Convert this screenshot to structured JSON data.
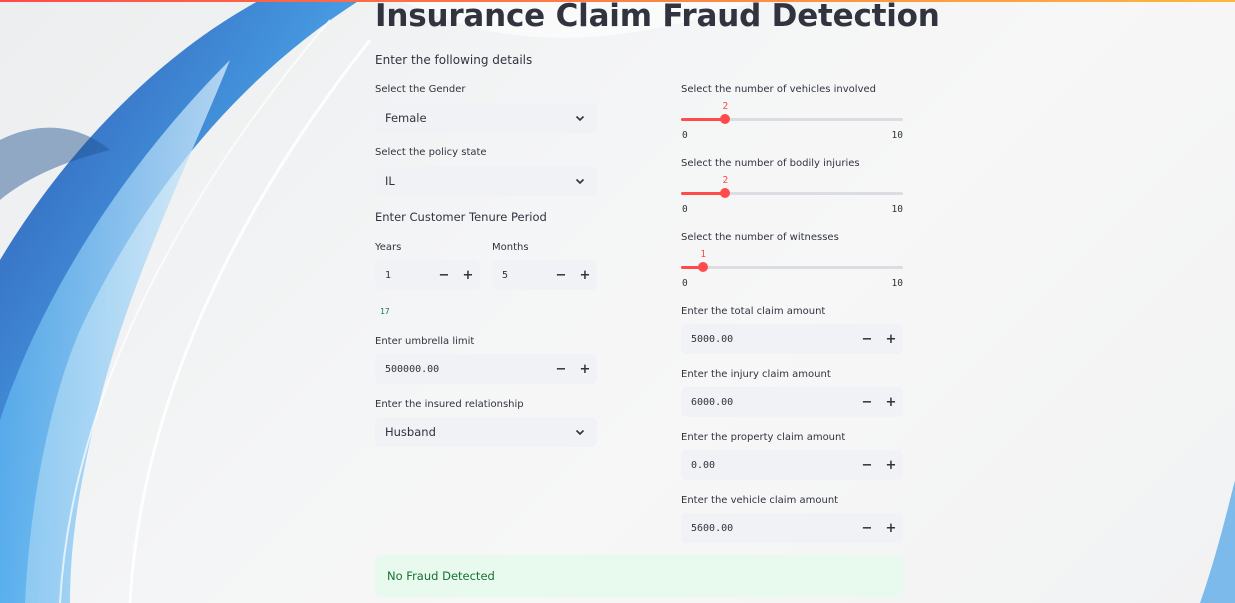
{
  "app": {
    "title": "Insurance Claim Fraud Detection",
    "intro": "Enter the following details"
  },
  "left": {
    "gender": {
      "label": "Select the Gender",
      "value": "Female"
    },
    "policy_state": {
      "label": "Select the policy state",
      "value": "IL"
    },
    "tenure": {
      "label": "Enter Customer Tenure Period",
      "years_label": "Years",
      "years_value": "1",
      "months_label": "Months",
      "months_value": "5",
      "total": "17"
    },
    "umbrella": {
      "label": "Enter umbrella limit",
      "value": "500000.00"
    },
    "relationship": {
      "label": "Enter the insured relationship",
      "value": "Husband"
    }
  },
  "right": {
    "vehicles": {
      "label": "Select the number of vehicles involved",
      "value": 2,
      "value_text": "2",
      "min": "0",
      "max": "10"
    },
    "injuries": {
      "label": "Select the number of bodily injuries",
      "value": 2,
      "value_text": "2",
      "min": "0",
      "max": "10"
    },
    "witnesses": {
      "label": "Select the number of witnesses",
      "value": 1,
      "value_text": "1",
      "min": "0",
      "max": "10"
    },
    "total_claim": {
      "label": "Enter the total claim amount",
      "value": "5000.00"
    },
    "injury_claim": {
      "label": "Enter the injury claim amount",
      "value": "6000.00"
    },
    "property_claim": {
      "label": "Enter the property claim amount",
      "value": "0.00"
    },
    "vehicle_claim": {
      "label": "Enter the vehicle claim amount",
      "value": "5600.00"
    }
  },
  "stepper": {
    "minus": "−",
    "plus": "+"
  },
  "result": {
    "text": "No Fraud Detected"
  },
  "colors": {
    "accent": "#ff4b4b",
    "success_bg": "#e8f9ee",
    "success_text": "#177233",
    "input_bg": "#f0f2f6"
  },
  "icons": {
    "select": "chevron-down-icon"
  }
}
